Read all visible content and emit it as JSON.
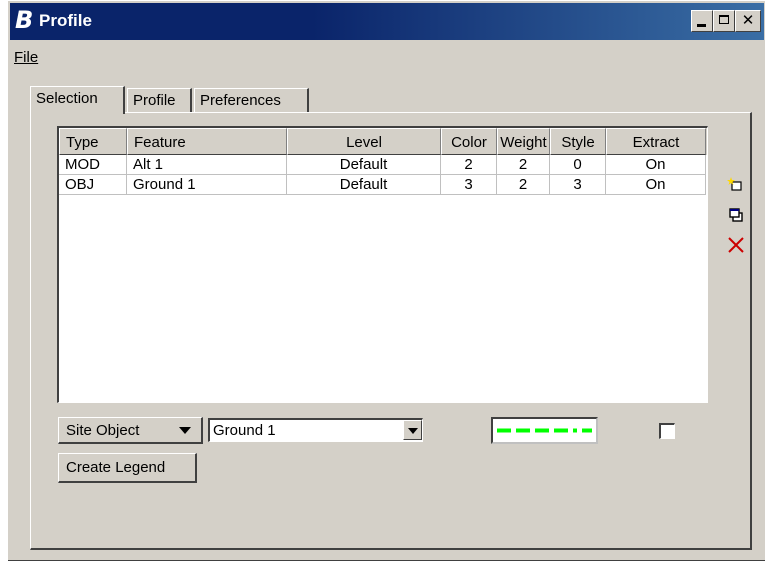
{
  "window": {
    "title": "Profile",
    "logo": "bentley-b-logo"
  },
  "menu": {
    "file": "File"
  },
  "tabs": [
    {
      "label": "Selection",
      "active": true
    },
    {
      "label": "Profile",
      "active": false
    },
    {
      "label": "Preferences",
      "active": false
    }
  ],
  "table": {
    "columns": [
      "Type",
      "Feature",
      "Level",
      "Color",
      "Weight",
      "Style",
      "Extract"
    ],
    "rows": [
      {
        "type": "MOD",
        "feature": "Alt 1",
        "level": "Default",
        "color": "2",
        "weight": "2",
        "style": "0",
        "extract": "On"
      },
      {
        "type": "OBJ",
        "feature": "Ground 1",
        "level": "Default",
        "color": "3",
        "weight": "2",
        "style": "3",
        "extract": "On"
      }
    ]
  },
  "side_icons": [
    "new-item-icon",
    "copy-icon",
    "delete-icon"
  ],
  "controls": {
    "type_dropdown": "Site Object",
    "feature_combo": "Ground 1",
    "line_style_color": "#00ff00",
    "extract_checked": false,
    "create_legend": "Create Legend"
  },
  "colors": {
    "titlebar": "#0a246a",
    "face": "#d4d0c8",
    "delete_icon": "#cc0000"
  }
}
